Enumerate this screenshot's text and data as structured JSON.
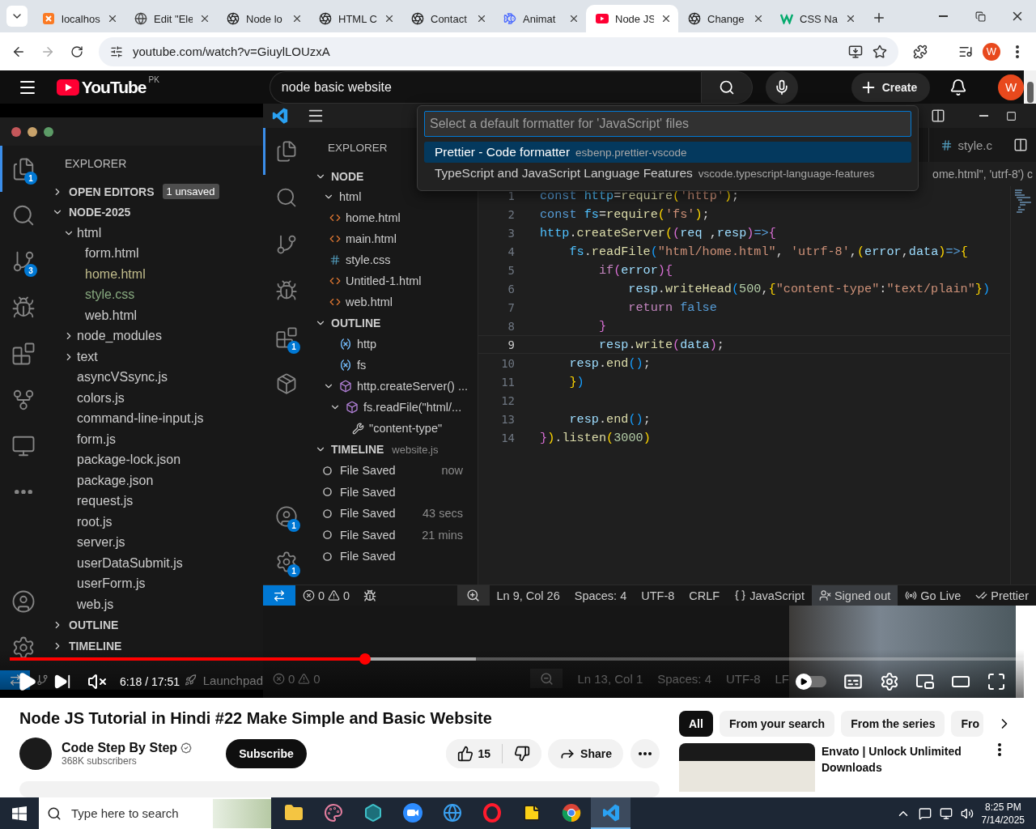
{
  "browser": {
    "tabs": [
      {
        "title": "localhos",
        "kind": "square",
        "selected": false
      },
      {
        "title": "Edit \"Ele",
        "kind": "globe",
        "selected": false
      },
      {
        "title": "Node lo",
        "kind": "aperture",
        "selected": false
      },
      {
        "title": "HTML C",
        "kind": "aperture",
        "selected": false
      },
      {
        "title": "Contact",
        "kind": "aperture",
        "selected": false
      },
      {
        "title": "Animat",
        "kind": "fish",
        "selected": false
      },
      {
        "title": "Node JS",
        "kind": "play",
        "selected": true
      },
      {
        "title": "Change",
        "kind": "aperture",
        "selected": false
      },
      {
        "title": "CSS Na",
        "kind": "zigzag",
        "selected": false
      }
    ],
    "url": "youtube.com/watch?v=GiuylLOUzxA",
    "profile": "W"
  },
  "youtube": {
    "logo": "YouTube",
    "country": "PK",
    "search": "node basic website",
    "create": "Create",
    "profile": "W"
  },
  "player": {
    "mac_editor": {
      "activity": [
        {
          "kind": "files",
          "badge": "1",
          "selected": true
        },
        {
          "kind": "search",
          "selected": false
        },
        {
          "kind": "source-control",
          "badge": "3",
          "selected": false
        },
        {
          "kind": "run",
          "selected": false
        },
        {
          "kind": "extensions",
          "selected": false
        },
        {
          "kind": "graph",
          "selected": false
        },
        {
          "kind": "remote",
          "selected": false
        },
        {
          "kind": "more",
          "selected": false
        }
      ],
      "activity_bottom": [
        {
          "kind": "account",
          "selected": false
        },
        {
          "kind": "settings",
          "selected": false
        }
      ],
      "explorer": "EXPLORER",
      "sections": [
        {
          "label": "OPEN EDITORS",
          "badge": "1 unsaved",
          "expanded": false
        },
        {
          "label": "NODE-2025",
          "expanded": true,
          "tree": [
            {
              "kind": "folder",
              "label": "html",
              "expanded": true,
              "children": [
                {
                  "kind": "file",
                  "label": "form.html",
                  "color": "#cccccc"
                },
                {
                  "kind": "file",
                  "label": "home.html",
                  "color": "#c2bd8c"
                },
                {
                  "kind": "file",
                  "label": "style.css",
                  "color": "#87a97f"
                },
                {
                  "kind": "file",
                  "label": "web.html",
                  "color": "#cccccc"
                }
              ]
            },
            {
              "kind": "folder",
              "label": "node_modules",
              "expanded": false
            },
            {
              "kind": "folder",
              "label": "text",
              "expanded": false
            },
            {
              "kind": "file",
              "label": "asyncVSsync.js",
              "color": "#cccccc"
            },
            {
              "kind": "file",
              "label": "colors.js",
              "color": "#cccccc"
            },
            {
              "kind": "file",
              "label": "command-line-input.js",
              "color": "#cccccc"
            },
            {
              "kind": "file",
              "label": "form.js",
              "color": "#cccccc"
            },
            {
              "kind": "file",
              "label": "package-lock.json",
              "color": "#cccccc"
            },
            {
              "kind": "file",
              "label": "package.json",
              "color": "#cccccc"
            },
            {
              "kind": "file",
              "label": "request.js",
              "color": "#cccccc"
            },
            {
              "kind": "file",
              "label": "root.js",
              "color": "#cccccc"
            },
            {
              "kind": "file",
              "label": "server.js",
              "color": "#cccccc"
            },
            {
              "kind": "file",
              "label": "userDataSubmit.js",
              "color": "#cccccc"
            },
            {
              "kind": "file",
              "label": "userForm.js",
              "color": "#cccccc"
            },
            {
              "kind": "file",
              "label": "web.js",
              "color": "#cccccc"
            }
          ]
        },
        {
          "label": "OUTLINE",
          "expanded": false
        },
        {
          "label": "TIMELINE",
          "expanded": false
        }
      ],
      "status": {
        "launchpad": "Launchpad"
      }
    },
    "vscode": {
      "palette": {
        "placeholder": "Select a default formatter for 'JavaScript' files",
        "options": [
          {
            "label": "Prettier - Code formatter",
            "detail": "esbenp.prettier-vscode",
            "selected": true
          },
          {
            "label": "TypeScript and JavaScript Language Features",
            "detail": "vscode.typescript-language-features",
            "selected": false
          }
        ]
      },
      "activity": [
        {
          "kind": "files",
          "selected": true
        },
        {
          "kind": "search",
          "selected": false
        },
        {
          "kind": "source-control",
          "selected": false
        },
        {
          "kind": "run",
          "selected": false
        },
        {
          "kind": "extensions",
          "badge": "1",
          "selected": false
        },
        {
          "kind": "package",
          "selected": false
        }
      ],
      "activity_bottom": [
        {
          "kind": "account",
          "badge": "1",
          "selected": false
        },
        {
          "kind": "settings",
          "badge": "1",
          "selected": false
        }
      ],
      "sidebar": {
        "title": "EXPLORER",
        "sections": [
          {
            "kind": "files",
            "label": "NODE",
            "expanded": true,
            "tree": [
              {
                "kind": "folder",
                "label": "html",
                "expanded": true,
                "children": [
                  {
                    "kind": "html",
                    "label": "home.html"
                  },
                  {
                    "kind": "html",
                    "label": "main.html"
                  },
                  {
                    "kind": "css",
                    "label": "style.css"
                  },
                  {
                    "kind": "html",
                    "label": "Untitled-1.html"
                  },
                  {
                    "kind": "html",
                    "label": "web.html"
                  }
                ]
              }
            ]
          },
          {
            "kind": "outline",
            "label": "OUTLINE",
            "expanded": true,
            "tree": [
              {
                "kind": "variable",
                "label": "http"
              },
              {
                "kind": "variable",
                "label": "fs"
              },
              {
                "kind": "method",
                "label": "http.createServer() ...",
                "expanded": true,
                "children": [
                  {
                    "kind": "method",
                    "label": "fs.readFile(\"html/...",
                    "expanded": true,
                    "children": [
                      {
                        "kind": "property",
                        "label": "\"content-type\""
                      }
                    ]
                  }
                ]
              }
            ]
          },
          {
            "kind": "timeline",
            "label": "TIMELINE",
            "detail": "website.js",
            "expanded": true,
            "entries": [
              {
                "label": "File Saved",
                "time": "now"
              },
              {
                "label": "File Saved"
              },
              {
                "label": "File Saved",
                "time": "43 secs"
              },
              {
                "label": "File Saved",
                "time": "21 mins"
              },
              {
                "label": "File Saved"
              }
            ]
          }
        ]
      },
      "editor_tab": "style.c",
      "breadcrumb": "ome.html\", 'utrf-8') c",
      "lines": [
        {
          "n": "1",
          "current": false,
          "tokens": [
            {
              "kind": "keyword",
              "text": "const "
            },
            {
              "kind": "constant",
              "text": "http"
            },
            {
              "kind": "punct",
              "text": "="
            },
            {
              "kind": "function",
              "text": "require"
            },
            {
              "kind": "bracket1",
              "text": "("
            },
            {
              "kind": "string",
              "text": "'http'"
            },
            {
              "kind": "bracket1",
              "text": ")"
            },
            {
              "kind": "punct",
              "text": ";"
            }
          ]
        },
        {
          "n": "2",
          "current": false,
          "tokens": [
            {
              "kind": "keyword",
              "text": "const "
            },
            {
              "kind": "constant",
              "text": "fs"
            },
            {
              "kind": "punct",
              "text": "="
            },
            {
              "kind": "function",
              "text": "require"
            },
            {
              "kind": "bracket1",
              "text": "("
            },
            {
              "kind": "string",
              "text": "'fs'"
            },
            {
              "kind": "bracket1",
              "text": ")"
            },
            {
              "kind": "punct",
              "text": ";"
            }
          ]
        },
        {
          "n": "3",
          "current": false,
          "tokens": [
            {
              "kind": "constant",
              "text": "http"
            },
            {
              "kind": "punct",
              "text": "."
            },
            {
              "kind": "function",
              "text": "createServer"
            },
            {
              "kind": "bracket1",
              "text": "("
            },
            {
              "kind": "bracket2",
              "text": "("
            },
            {
              "kind": "variable",
              "text": "req"
            },
            {
              "kind": "punct",
              "text": " ,"
            },
            {
              "kind": "variable",
              "text": "resp"
            },
            {
              "kind": "bracket2",
              "text": ")"
            },
            {
              "kind": "keyword",
              "text": "=>"
            },
            {
              "kind": "bracket2",
              "text": "{"
            }
          ]
        },
        {
          "n": "4",
          "current": false,
          "tokens": [
            {
              "kind": "constant",
              "text": "    fs"
            },
            {
              "kind": "punct",
              "text": "."
            },
            {
              "kind": "function",
              "text": "readFile"
            },
            {
              "kind": "bracket3",
              "text": "("
            },
            {
              "kind": "string",
              "text": "\"html/home.html\""
            },
            {
              "kind": "punct",
              "text": ", "
            },
            {
              "kind": "string",
              "text": "'utrf-8'"
            },
            {
              "kind": "punct",
              "text": ","
            },
            {
              "kind": "bracket1",
              "text": "("
            },
            {
              "kind": "variable",
              "text": "error"
            },
            {
              "kind": "punct",
              "text": ","
            },
            {
              "kind": "variable",
              "text": "data"
            },
            {
              "kind": "bracket1",
              "text": ")"
            },
            {
              "kind": "keyword",
              "text": "=>"
            },
            {
              "kind": "bracket1",
              "text": "{"
            }
          ]
        },
        {
          "n": "5",
          "current": false,
          "tokens": [
            {
              "kind": "control",
              "text": "        if"
            },
            {
              "kind": "bracket2",
              "text": "("
            },
            {
              "kind": "variable",
              "text": "error"
            },
            {
              "kind": "bracket2",
              "text": ")"
            },
            {
              "kind": "bracket2",
              "text": "{"
            }
          ]
        },
        {
          "n": "6",
          "current": false,
          "tokens": [
            {
              "kind": "variable",
              "text": "            resp"
            },
            {
              "kind": "punct",
              "text": "."
            },
            {
              "kind": "function",
              "text": "writeHead"
            },
            {
              "kind": "bracket3",
              "text": "("
            },
            {
              "kind": "number",
              "text": "500"
            },
            {
              "kind": "punct",
              "text": ","
            },
            {
              "kind": "bracket1",
              "text": "{"
            },
            {
              "kind": "string",
              "text": "\"content-type\""
            },
            {
              "kind": "punct",
              "text": ":"
            },
            {
              "kind": "string",
              "text": "\"text/plain\""
            },
            {
              "kind": "bracket1",
              "text": "}"
            },
            {
              "kind": "bracket3",
              "text": ")"
            }
          ]
        },
        {
          "n": "7",
          "current": false,
          "tokens": [
            {
              "kind": "control",
              "text": "            return "
            },
            {
              "kind": "keyword",
              "text": "false"
            }
          ]
        },
        {
          "n": "8",
          "current": false,
          "tokens": [
            {
              "kind": "bracket2",
              "text": "        }"
            }
          ]
        },
        {
          "n": "9",
          "current": true,
          "tokens": [
            {
              "kind": "variable",
              "text": "        resp"
            },
            {
              "kind": "punct",
              "text": "."
            },
            {
              "kind": "function",
              "text": "write"
            },
            {
              "kind": "bracket2",
              "text": "("
            },
            {
              "kind": "variable",
              "text": "data"
            },
            {
              "kind": "bracket2",
              "text": ")"
            },
            {
              "kind": "punct",
              "text": ";"
            }
          ]
        },
        {
          "n": "10",
          "current": false,
          "tokens": [
            {
              "kind": "variable",
              "text": "    resp"
            },
            {
              "kind": "punct",
              "text": "."
            },
            {
              "kind": "function",
              "text": "end"
            },
            {
              "kind": "bracket3",
              "text": "()"
            },
            {
              "kind": "punct",
              "text": ";"
            }
          ]
        },
        {
          "n": "11",
          "current": false,
          "tokens": [
            {
              "kind": "bracket1",
              "text": "    }"
            },
            {
              "kind": "bracket3",
              "text": ")"
            }
          ]
        },
        {
          "n": "12",
          "current": false
        },
        {
          "n": "13",
          "current": false,
          "tokens": [
            {
              "kind": "variable",
              "text": "    resp"
            },
            {
              "kind": "punct",
              "text": "."
            },
            {
              "kind": "function",
              "text": "end"
            },
            {
              "kind": "bracket3",
              "text": "()"
            },
            {
              "kind": "punct",
              "text": ";"
            }
          ]
        },
        {
          "n": "14",
          "current": false,
          "tokens": [
            {
              "kind": "bracket2",
              "text": "}"
            },
            {
              "kind": "bracket1",
              "text": ")"
            },
            {
              "kind": "punct",
              "text": "."
            },
            {
              "kind": "function",
              "text": "listen"
            },
            {
              "kind": "bracket1",
              "text": "("
            },
            {
              "kind": "number",
              "text": "3000"
            },
            {
              "kind": "bracket1",
              "text": ")"
            }
          ]
        }
      ],
      "status": {
        "errors": "0",
        "warnings": "0",
        "items": [
          {
            "kind": "text",
            "text": "Ln 9, Col 26"
          },
          {
            "kind": "text",
            "text": "Spaces: 4"
          },
          {
            "kind": "text",
            "text": "UTF-8"
          },
          {
            "kind": "text",
            "text": "CRLF"
          },
          {
            "kind": "language",
            "text": "JavaScript"
          },
          {
            "kind": "account",
            "text": "Signed out"
          },
          {
            "kind": "live",
            "text": "Go Live"
          },
          {
            "kind": "formatter",
            "text": "Prettier"
          }
        ]
      }
    },
    "lower_status": {
      "errors": "0",
      "warnings": "0",
      "items": [
        "Ln 13, Col 1",
        "Spaces: 4",
        "UTF-8",
        "LF"
      ]
    },
    "controls": {
      "progress": {
        "level": 0.35
      },
      "buffer": {
        "level": 0.46
      },
      "muted": true,
      "time": "6:18 / 17:51",
      "autoplay": {
        "on": false
      }
    }
  },
  "video_info": {
    "title": "Node JS Tutorial in Hindi #22 Make Simple and Basic Website",
    "channel": "Code Step By Step",
    "verified": true,
    "subscribers": "368K subscribers",
    "subscribe": "Subscribe",
    "likes": "15",
    "share": "Share"
  },
  "related": {
    "chips": [
      {
        "label": "All",
        "selected": true
      },
      {
        "label": "From your search",
        "selected": false
      },
      {
        "label": "From the series",
        "selected": false
      },
      {
        "label": "Fro",
        "selected": false
      }
    ],
    "videos": [
      {
        "title": "Envato | Unlock Unlimited Downloads"
      }
    ]
  },
  "taskbar": {
    "search_placeholder": "Type here to search",
    "apps": [
      {
        "kind": "folder",
        "active": false
      },
      {
        "kind": "paint",
        "active": false
      },
      {
        "kind": "hexagon",
        "active": false
      },
      {
        "kind": "video",
        "active": false
      },
      {
        "kind": "globe",
        "active": false
      },
      {
        "kind": "ring",
        "active": false
      },
      {
        "kind": "note",
        "active": false
      },
      {
        "kind": "wheel",
        "active": false
      },
      {
        "kind": "ribbon",
        "active": true
      }
    ],
    "time": "8:25 PM",
    "date": "7/14/2025"
  }
}
